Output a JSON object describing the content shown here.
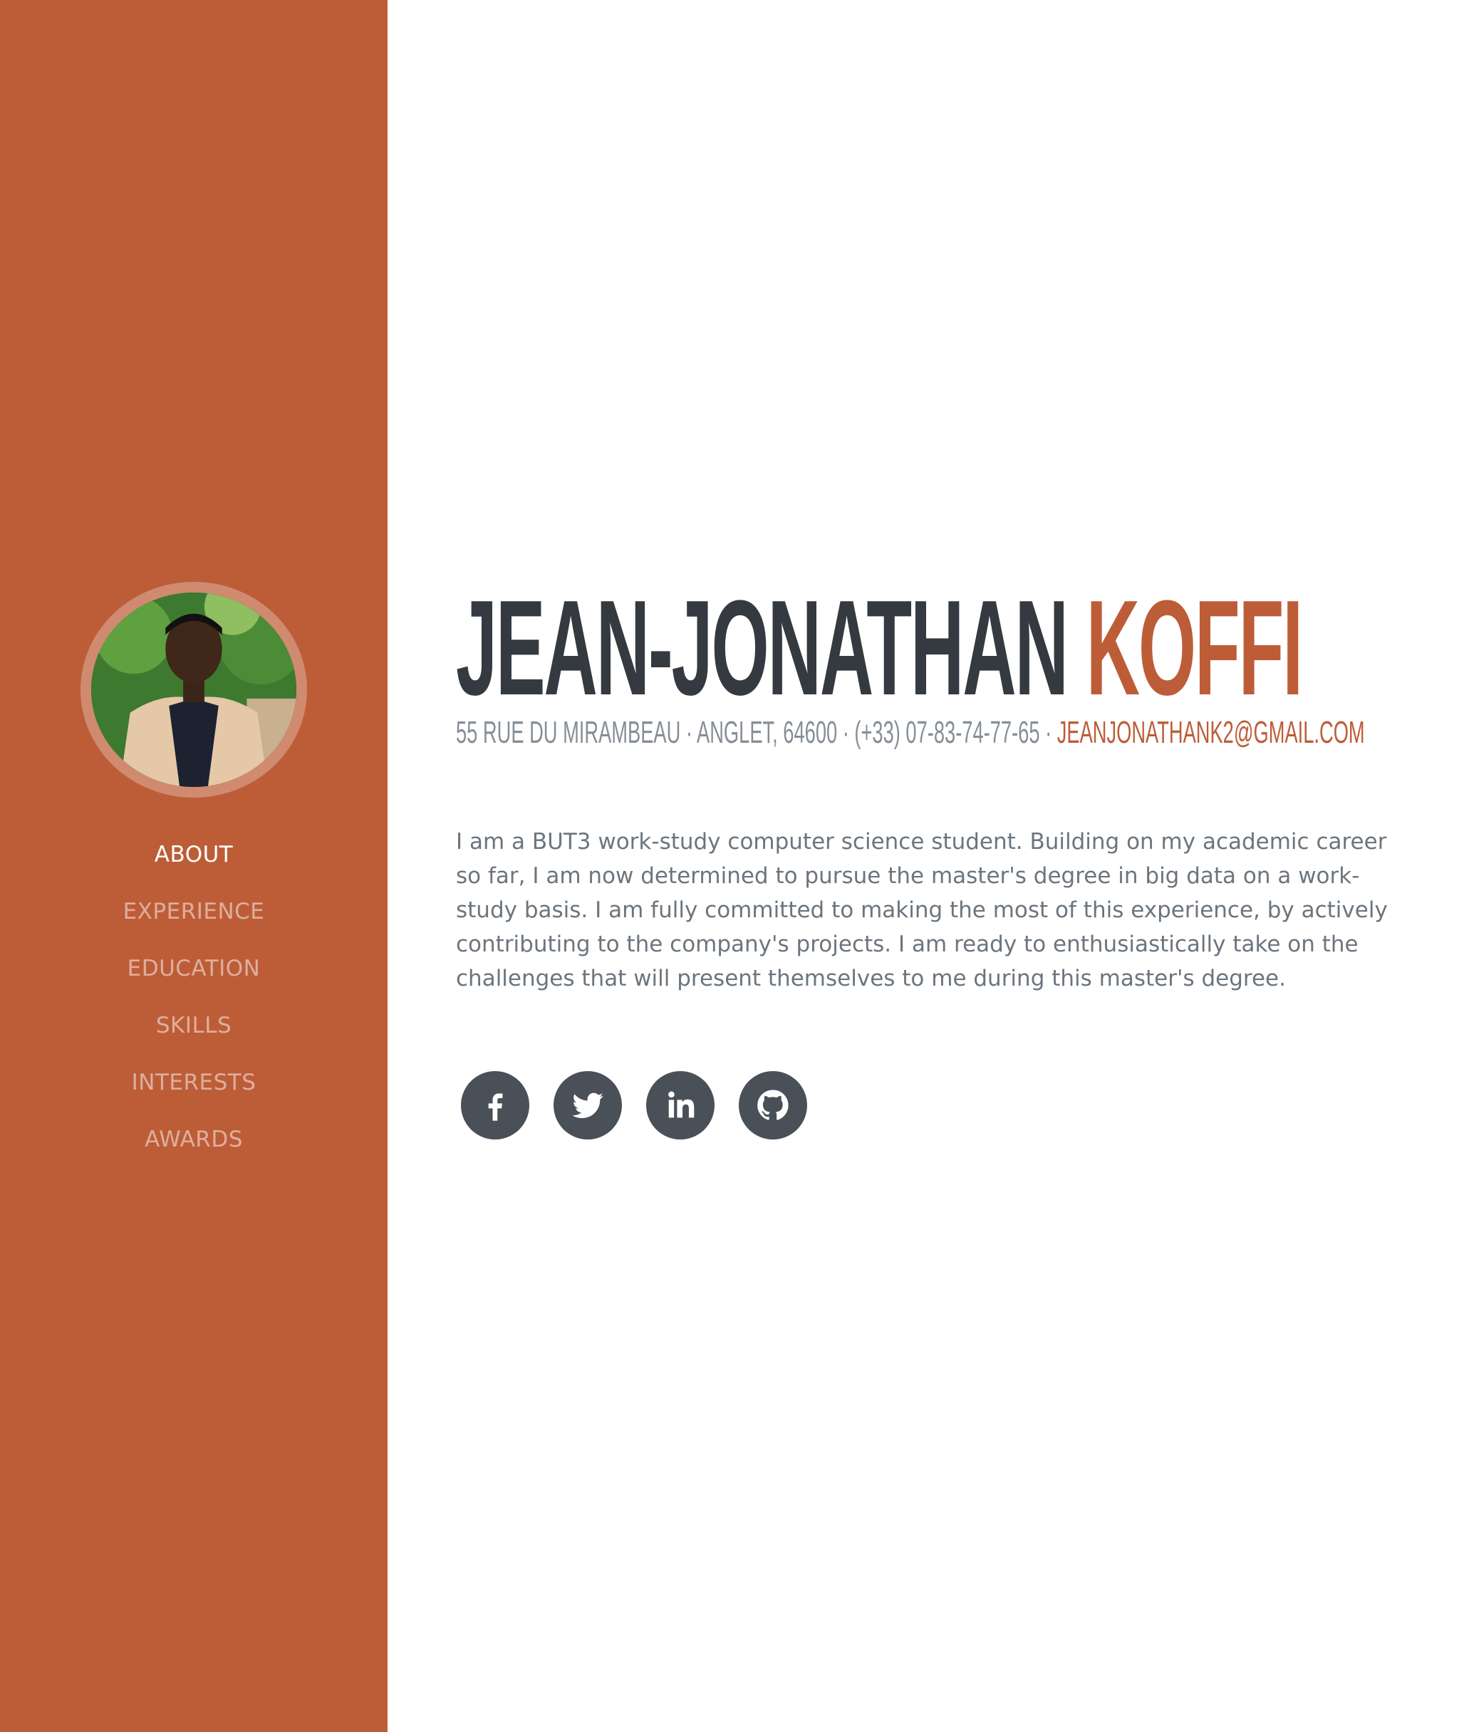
{
  "sidebar": {
    "nav": [
      {
        "label": "ABOUT",
        "active": true
      },
      {
        "label": "EXPERIENCE",
        "active": false
      },
      {
        "label": "EDUCATION",
        "active": false
      },
      {
        "label": "SKILLS",
        "active": false
      },
      {
        "label": "INTERESTS",
        "active": false
      },
      {
        "label": "AWARDS",
        "active": false
      }
    ]
  },
  "about": {
    "first_name": "JEAN-JONATHAN",
    "last_name": "KOFFI",
    "address": "55 RUE DU MIRAMBEAU · ANGLET, 64600 · (+33) 07-83-74-77-65 · ",
    "email": "JEANJONATHANK2@GMAIL.COM",
    "lead": "I am a BUT3 work-study computer science student. Building on my academic career so far, I am now determined to pursue the master's degree in big data on a work-study basis. I am fully committed to making the most of this experience, by actively contributing to the company's projects. I am ready to enthusiastically take on the challenges that will present themselves to me during this master's degree."
  },
  "social": [
    {
      "icon": "facebook-icon"
    },
    {
      "icon": "twitter-icon"
    },
    {
      "icon": "linkedin-icon"
    },
    {
      "icon": "github-icon"
    }
  ],
  "colors": {
    "primary": "#bd5d38",
    "dark": "#343a40",
    "muted": "#868e96"
  }
}
